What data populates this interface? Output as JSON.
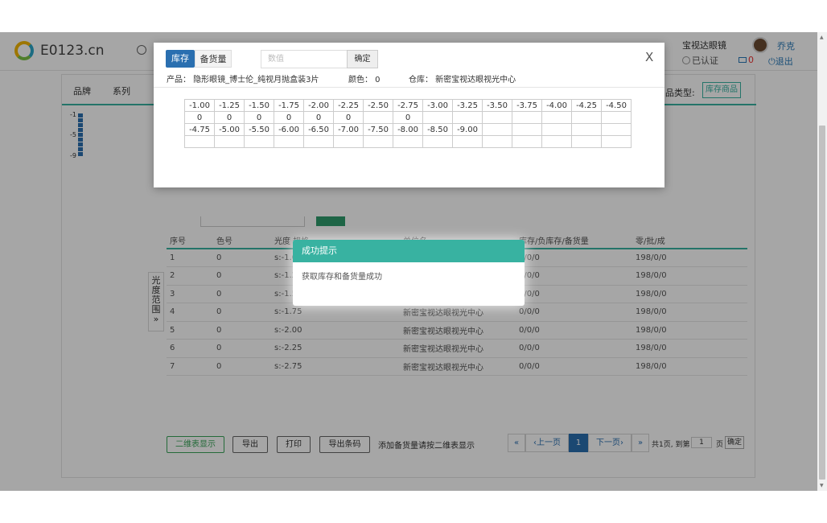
{
  "header": {
    "logo_text": "E0123.cn",
    "store_name": "宝视达眼镜",
    "verified": "已认证",
    "user_name": "乔克",
    "message_count": "0",
    "logout": "退出"
  },
  "filters": {
    "brand": "品牌",
    "series": "系列",
    "stock_type_label": "品类型:",
    "stock_type_value": "库存商品"
  },
  "range": {
    "labels": [
      "-1",
      "-5",
      "-9"
    ],
    "side_tab": "光度范围 »"
  },
  "table": {
    "headers": [
      "序号",
      "色号",
      "光度 规格",
      "单位名",
      "库存/负库存/备货量",
      "零/批/成"
    ],
    "rows": [
      [
        "1",
        "0",
        "s:-1.00",
        "新密宝视达眼视光中心",
        "0/0/0",
        "198/0/0"
      ],
      [
        "2",
        "0",
        "s:-1.25",
        "新密宝视达眼视光中心",
        "0/0/0",
        "198/0/0"
      ],
      [
        "3",
        "0",
        "s:-1.50",
        "新密宝视达眼视光中心",
        "0/0/0",
        "198/0/0"
      ],
      [
        "4",
        "0",
        "s:-1.75",
        "新密宝视达眼视光中心",
        "0/0/0",
        "198/0/0"
      ],
      [
        "5",
        "0",
        "s:-2.00",
        "新密宝视达眼视光中心",
        "0/0/0",
        "198/0/0"
      ],
      [
        "6",
        "0",
        "s:-2.25",
        "新密宝视达眼视光中心",
        "0/0/0",
        "198/0/0"
      ],
      [
        "7",
        "0",
        "s:-2.75",
        "新密宝视达眼视光中心",
        "0/0/0",
        "198/0/0"
      ]
    ]
  },
  "bottom": {
    "qr_btn": "二维表显示",
    "export_btn": "导出",
    "print_btn": "打印",
    "export_barcode_btn": "导出条码",
    "hint": "添加备货量请按二维表显示",
    "pager": {
      "first": "«",
      "prev": "‹上一页",
      "current": "1",
      "next": "下一页›",
      "last": "»",
      "info": "共1页, 到第",
      "goto_value": "1",
      "unit": "页",
      "confirm": "确定"
    }
  },
  "modal": {
    "tab_stock": "库存",
    "tab_reserve": "备货量",
    "qty_placeholder": "数值",
    "confirm": "确定",
    "close": "X",
    "product": "产品：  隐形眼镜_博士伦_纯视月抛盒装3片",
    "color": "颜色：  0",
    "warehouse": "仓库：  新密宝视达眼视光中心",
    "grid": [
      [
        "-1.00",
        "-1.25",
        "-1.50",
        "-1.75",
        "-2.00",
        "-2.25",
        "-2.50",
        "-2.75",
        "-3.00",
        "-3.25",
        "-3.50",
        "-3.75",
        "-4.00",
        "-4.25",
        "-4.50"
      ],
      [
        "0",
        "0",
        "0",
        "0",
        "0",
        "0",
        "",
        "0",
        "",
        "",
        "",
        "",
        "",
        "",
        ""
      ],
      [
        "-4.75",
        "-5.00",
        "-5.50",
        "-6.00",
        "-6.50",
        "-7.00",
        "-7.50",
        "-8.00",
        "-8.50",
        "-9.00",
        "",
        "",
        "",
        "",
        ""
      ],
      [
        "",
        "",
        "",
        "",
        "",
        "",
        "",
        "",
        "",
        "",
        "",
        "",
        "",
        "",
        ""
      ]
    ]
  },
  "toast": {
    "title": "成功提示",
    "message": "获取库存和备货量成功"
  },
  "colors": {
    "accent": "#38b2a1",
    "primary": "#2a6fb0"
  }
}
